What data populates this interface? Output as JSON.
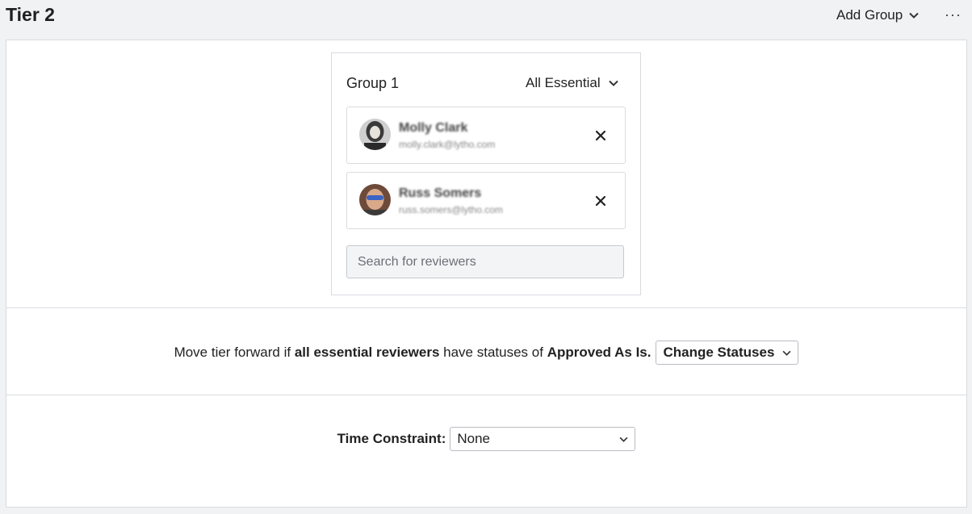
{
  "header": {
    "title": "Tier 2",
    "add_group_label": "Add Group",
    "more_label": "···"
  },
  "group": {
    "title": "Group 1",
    "requirement": "All Essential",
    "reviewers": [
      {
        "name": "Molly Clark",
        "email": "molly.clark@lytho.com"
      },
      {
        "name": "Russ Somers",
        "email": "russ.somers@lytho.com"
      }
    ],
    "search_placeholder": "Search for reviewers"
  },
  "rule": {
    "prefix": "Move tier forward if",
    "who": "all essential reviewers",
    "middle": "have statuses of",
    "status": "Approved As Is.",
    "button_label": "Change Statuses"
  },
  "time_constraint": {
    "label": "Time Constraint:",
    "value": "None"
  }
}
